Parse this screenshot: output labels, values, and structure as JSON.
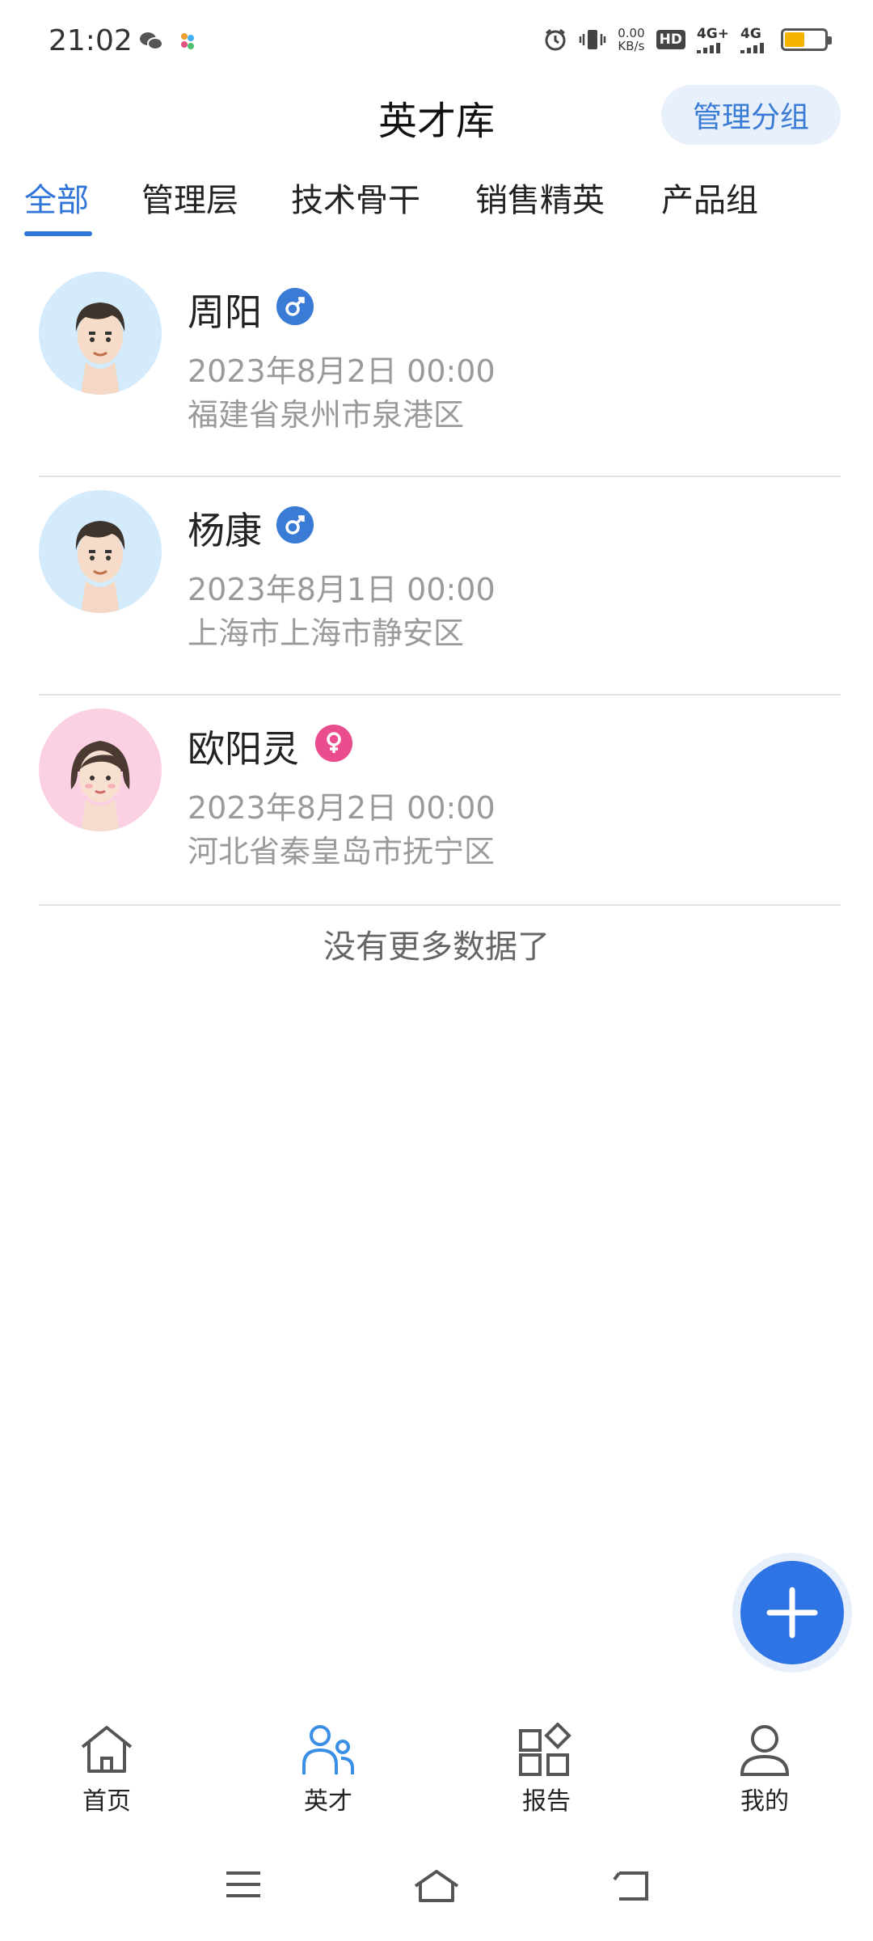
{
  "status_bar": {
    "time": "21:02",
    "net_speed_value": "0.00",
    "net_speed_unit": "KB/s",
    "hd_label": "HD",
    "sim1": "4G+",
    "sim2": "4G"
  },
  "header": {
    "title": "英才库",
    "manage_button": "管理分组"
  },
  "tabs": [
    {
      "label": "全部",
      "active": true
    },
    {
      "label": "管理层",
      "active": false
    },
    {
      "label": "技术骨干",
      "active": false
    },
    {
      "label": "销售精英",
      "active": false
    },
    {
      "label": "产品组",
      "active": false
    }
  ],
  "talents": [
    {
      "name": "周阳",
      "gender": "male",
      "date": "2023年8月2日 00:00",
      "location": "福建省泉州市泉港区"
    },
    {
      "name": "杨康",
      "gender": "male",
      "date": "2023年8月1日 00:00",
      "location": "上海市上海市静安区"
    },
    {
      "name": "欧阳灵",
      "gender": "female",
      "date": "2023年8月2日 00:00",
      "location": "河北省秦皇岛市抚宁区"
    }
  ],
  "list_footer": "没有更多数据了",
  "fab_icon": "plus-icon",
  "bottom_nav": [
    {
      "label": "首页",
      "icon": "home-icon",
      "active": false
    },
    {
      "label": "英才",
      "icon": "people-icon",
      "active": true
    },
    {
      "label": "报告",
      "icon": "grid-icon",
      "active": false
    },
    {
      "label": "我的",
      "icon": "user-icon",
      "active": false
    }
  ],
  "colors": {
    "accent": "#2f74d8",
    "male": "#3a7bd5",
    "female": "#ea4d8e",
    "muted_text": "#9a9a9a"
  }
}
